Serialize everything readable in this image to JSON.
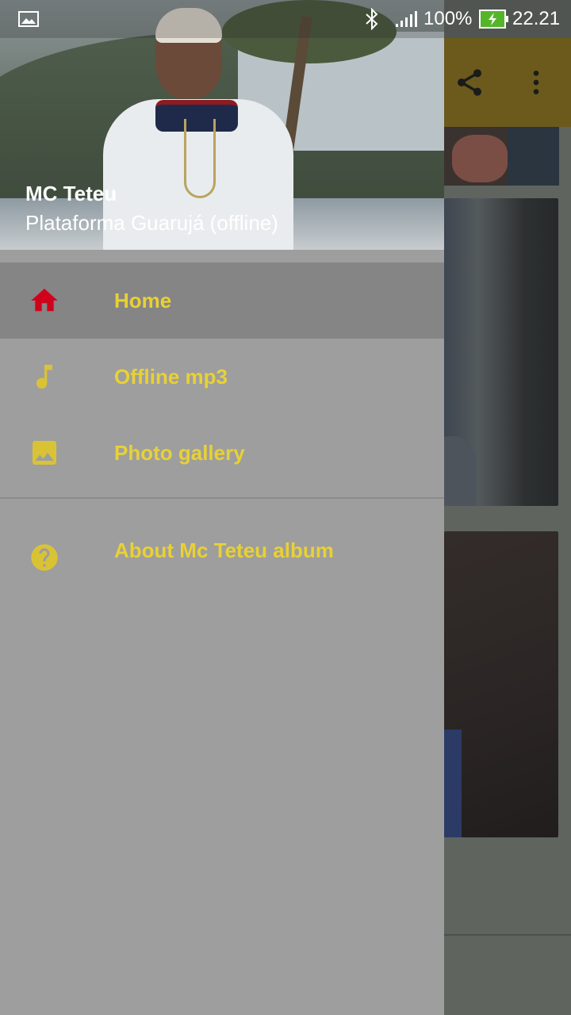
{
  "status_bar": {
    "battery_percent": "100%",
    "time": "22.21"
  },
  "app_toolbar": {
    "share_icon": "share-icon",
    "more_icon": "more-vertical-icon"
  },
  "drawer": {
    "header": {
      "title": "MC Teteu",
      "subtitle": "Plataforma Guarujá (offline)"
    },
    "items": [
      {
        "label": "Home",
        "icon": "home-icon",
        "active": true
      },
      {
        "label": "Offline mp3",
        "icon": "music-note-icon",
        "active": false
      },
      {
        "label": "Photo gallery",
        "icon": "image-icon",
        "active": false
      }
    ],
    "secondary_items": [
      {
        "label": "About Mc Teteu album",
        "icon": "help-icon",
        "active": false
      }
    ]
  },
  "colors": {
    "accent": "#e8d135",
    "active_icon": "#d0021b",
    "drawer_bg": "#9e9e9e",
    "active_item_bg": "#858585",
    "toolbar_dim": "#6b5a1c"
  }
}
